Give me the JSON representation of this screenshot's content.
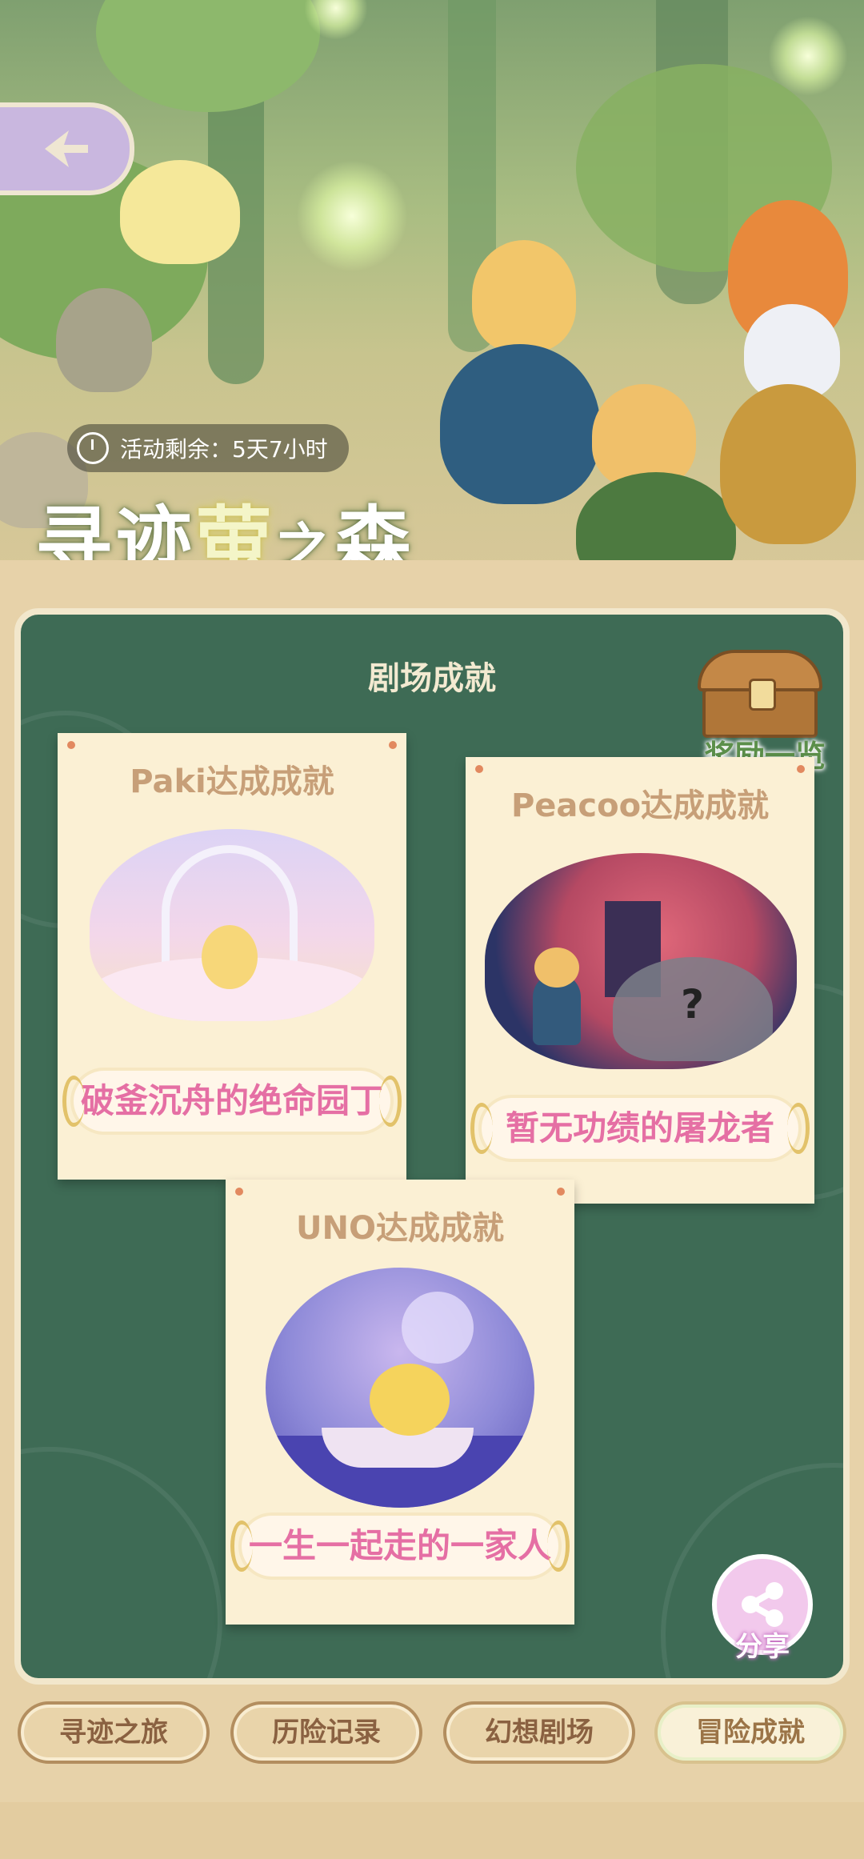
{
  "event": {
    "countdown": "活动剩余：5天7小时",
    "title_part1": "寻迹",
    "title_accent": "萤",
    "title_small": "之",
    "title_part2": "森"
  },
  "section": {
    "title": "剧场成就",
    "reward_label": "奖励一览"
  },
  "cards": [
    {
      "title": "Paki达成成就",
      "achievement": "破釜沉舟的绝命园丁"
    },
    {
      "title": "Peacoo达成成就",
      "achievement": "暂无功绩的屠龙者"
    },
    {
      "title": "UNO达成成就",
      "achievement": "一生一起走的一家人"
    }
  ],
  "share_label": "分享",
  "tabs": [
    {
      "label": "寻迹之旅",
      "active": false
    },
    {
      "label": "历险记录",
      "active": false
    },
    {
      "label": "幻想剧场",
      "active": false
    },
    {
      "label": "冒险成就",
      "active": true
    }
  ],
  "icons": [
    "back-arrow-icon",
    "clock-icon",
    "treasure-chest-icon",
    "share-icon"
  ],
  "colors": {
    "panel_green": "#3e6b55",
    "card_cream": "#fbf0d4",
    "achievement_pink": "#e56fa4",
    "frame_beige": "#e7d2a9"
  }
}
